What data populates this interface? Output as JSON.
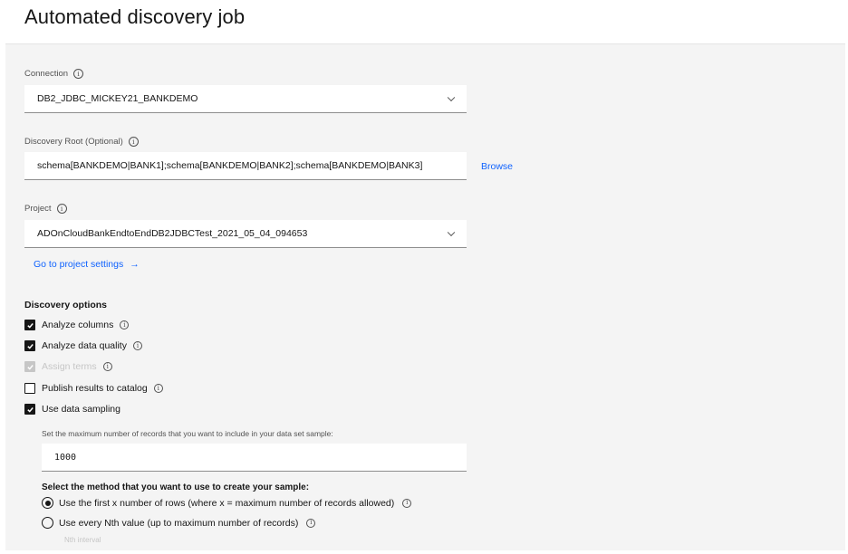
{
  "page": {
    "title": "Automated discovery job"
  },
  "connection": {
    "label": "Connection",
    "value": "DB2_JDBC_MICKEY21_BANKDEMO"
  },
  "discovery_root": {
    "label": "Discovery Root (Optional)",
    "value": "schema[BANKDEMO|BANK1];schema[BANKDEMO|BANK2];schema[BANKDEMO|BANK3]",
    "browse_label": "Browse"
  },
  "project": {
    "label": "Project",
    "value": "ADOnCloudBankEndtoEndDB2JDBCTest_2021_05_04_094653",
    "settings_link": "Go to project settings",
    "settings_arrow": "→"
  },
  "discovery_options": {
    "title": "Discovery options",
    "options": [
      {
        "label": "Analyze columns",
        "checked": true,
        "disabled": false,
        "info": true
      },
      {
        "label": "Analyze data quality",
        "checked": true,
        "disabled": false,
        "info": true
      },
      {
        "label": "Assign terms",
        "checked": true,
        "disabled": true,
        "info": true
      },
      {
        "label": "Publish results to catalog",
        "checked": false,
        "disabled": false,
        "info": true
      },
      {
        "label": "Use data sampling",
        "checked": true,
        "disabled": false,
        "info": false
      }
    ]
  },
  "sampling": {
    "max_records_label": "Set the maximum number of records that you want to include in your data set sample:",
    "max_records_value": "1000",
    "method_title": "Select the method that you want to use to create your sample:",
    "methods": [
      {
        "label": "Use the first x number of rows (where x = maximum number of records allowed)",
        "selected": true
      },
      {
        "label": "Use every Nth value (up to maximum number of records)",
        "selected": false
      }
    ],
    "nth_interval_label": "Nth interval"
  },
  "icons": {
    "info": "ⓘ",
    "info_glyph": "i"
  },
  "colors": {
    "link": "#0f62fe",
    "panel_bg": "#f4f4f4",
    "checkbox_checked": "#161616",
    "disabled": "#c6c6c6"
  }
}
